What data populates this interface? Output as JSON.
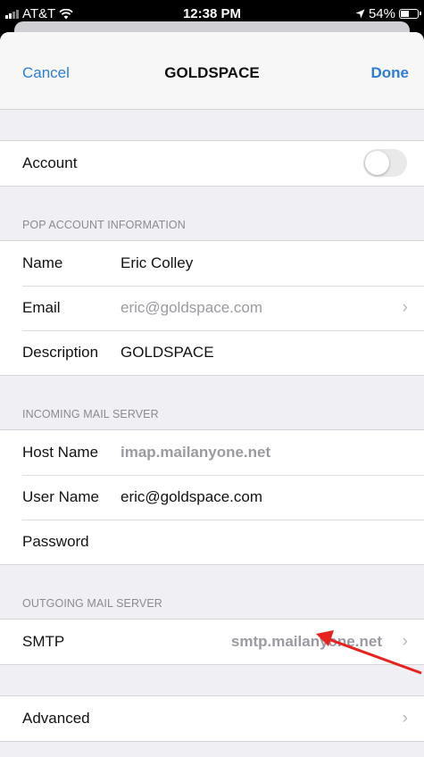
{
  "status": {
    "carrier": "AT&T",
    "time": "12:38 PM",
    "battery": "54%",
    "battery_level": 0.54
  },
  "nav": {
    "cancel": "Cancel",
    "title": "GOLDSPACE",
    "done": "Done"
  },
  "account": {
    "label": "Account",
    "enabled": false
  },
  "pop": {
    "header": "POP ACCOUNT INFORMATION",
    "name_label": "Name",
    "name_value": "Eric Colley",
    "email_label": "Email",
    "email_value": "eric@goldspace.com",
    "description_label": "Description",
    "description_value": "GOLDSPACE"
  },
  "incoming": {
    "header": "INCOMING MAIL SERVER",
    "host_label": "Host Name",
    "host_value": "imap.mailanyone.net",
    "user_label": "User Name",
    "user_value": "eric@goldspace.com",
    "password_label": "Password",
    "password_value": ""
  },
  "outgoing": {
    "header": "OUTGOING MAIL SERVER",
    "smtp_label": "SMTP",
    "smtp_value": "smtp.mailanyone.net"
  },
  "advanced": {
    "label": "Advanced"
  },
  "colors": {
    "accent": "#2c7cd8",
    "annotation_arrow": "#e8231f"
  }
}
